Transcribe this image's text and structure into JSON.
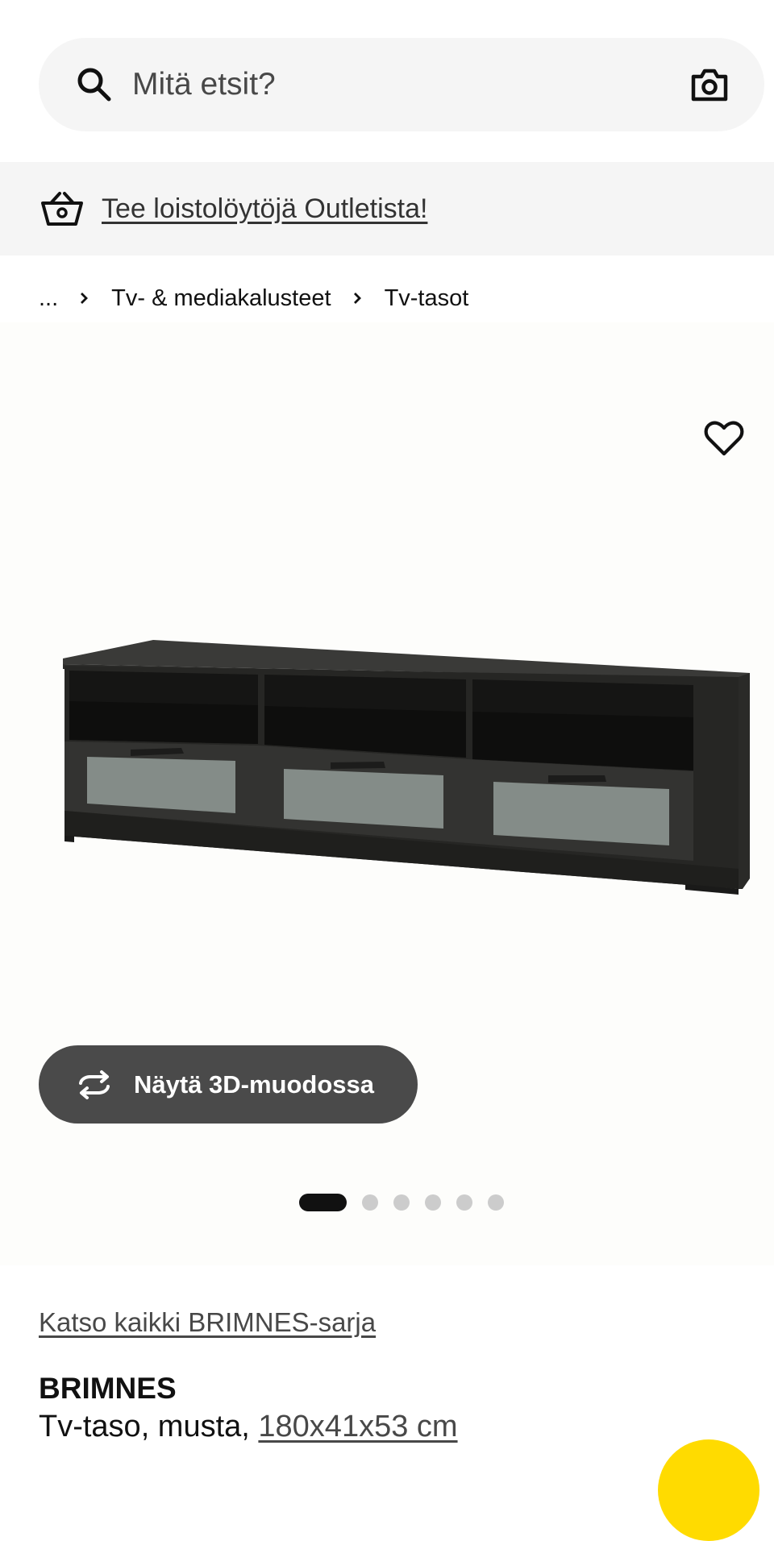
{
  "search": {
    "placeholder": "Mitä etsit?",
    "search_icon": "search-icon",
    "camera_icon": "camera-icon"
  },
  "promo": {
    "icon": "basket-icon",
    "text": "Tee loistolöytöjä Outletista!"
  },
  "breadcrumb": {
    "items": [
      "...",
      "Tv- & mediakalusteet",
      "Tv-tasot"
    ]
  },
  "gallery": {
    "favourite_icon": "heart-icon",
    "view_3d_label": "Näytä 3D-muodossa",
    "view_3d_icon": "rotate-icon",
    "image_count": 6,
    "active_image_index": 0
  },
  "product": {
    "series_link": "Katso kaikki BRIMNES-sarja",
    "name": "BRIMNES",
    "description_prefix": "Tv-taso, musta, ",
    "size": "180x41x53 cm"
  },
  "colors": {
    "accent_yellow": "#ffdb00",
    "button_dark": "#4a4a4a",
    "search_bg": "#f5f5f5"
  }
}
